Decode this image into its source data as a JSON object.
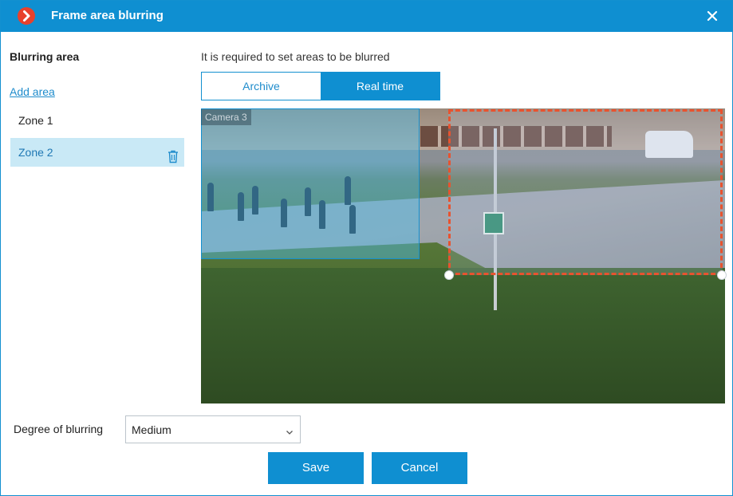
{
  "window": {
    "title": "Frame area blurring"
  },
  "left_panel": {
    "title": "Blurring area",
    "add_area": "Add area",
    "zones": [
      {
        "label": "Zone 1",
        "selected": false
      },
      {
        "label": "Zone 2",
        "selected": true
      }
    ]
  },
  "main": {
    "hint": "It is required to set areas to be blurred",
    "tabs": [
      {
        "label": "Archive",
        "active": false
      },
      {
        "label": "Real time",
        "active": true
      }
    ],
    "camera_label": "Camera 3"
  },
  "footer": {
    "degree_label": "Degree of blurring",
    "degree_value": "Medium",
    "save_label": "Save",
    "cancel_label": "Cancel"
  },
  "colors": {
    "accent": "#0f8fd1",
    "brand_icon": "#e8412c",
    "selected_zone_bg": "#c9e9f6",
    "zone2_border": "#e8532f"
  },
  "icons": {
    "app": "app-logo-icon",
    "close": "close-icon",
    "delete": "trash-icon",
    "dropdown": "chevron-down-icon"
  }
}
